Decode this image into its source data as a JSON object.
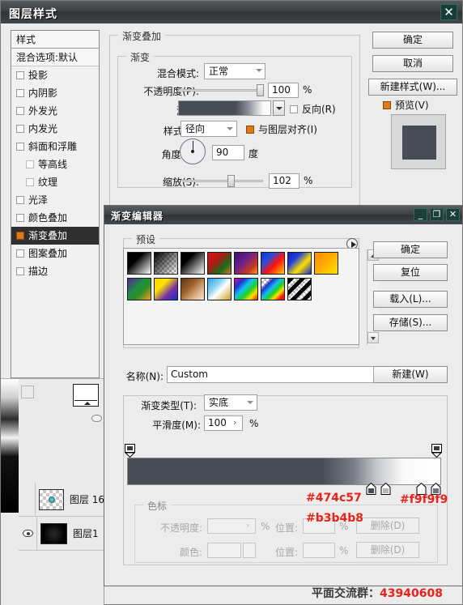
{
  "window": {
    "title": "图层样式",
    "close_label": "✕"
  },
  "sidebar": {
    "header": "样式",
    "blend_options": "混合选项:默认",
    "items": [
      {
        "label": "投影",
        "checked": false,
        "indent": false,
        "selected": false
      },
      {
        "label": "内阴影",
        "checked": false,
        "indent": false,
        "selected": false
      },
      {
        "label": "外发光",
        "checked": false,
        "indent": false,
        "selected": false
      },
      {
        "label": "内发光",
        "checked": false,
        "indent": false,
        "selected": false
      },
      {
        "label": "斜面和浮雕",
        "checked": false,
        "indent": false,
        "selected": false
      },
      {
        "label": "等高线",
        "checked": false,
        "indent": true,
        "selected": false
      },
      {
        "label": "纹理",
        "checked": false,
        "indent": true,
        "selected": false
      },
      {
        "label": "光泽",
        "checked": false,
        "indent": false,
        "selected": false
      },
      {
        "label": "颜色叠加",
        "checked": false,
        "indent": false,
        "selected": false
      },
      {
        "label": "渐变叠加",
        "checked": true,
        "indent": false,
        "selected": true
      },
      {
        "label": "图案叠加",
        "checked": false,
        "indent": false,
        "selected": false
      },
      {
        "label": "描边",
        "checked": false,
        "indent": false,
        "selected": false
      }
    ]
  },
  "commands": {
    "ok": "确定",
    "cancel": "取消",
    "new_style": "新建样式(W)...",
    "preview": "预览(V)"
  },
  "gradient_overlay": {
    "group_title": "渐变叠加",
    "sub_group_title": "渐变",
    "blend_mode_label": "混合模式:",
    "blend_mode_value": "正常",
    "opacity_label": "不透明度(P):",
    "opacity_value": "100",
    "opacity_unit": "%",
    "gradient_label": "渐变:",
    "reverse_label": "反向(R)",
    "style_label": "样式(L):",
    "style_value": "径向",
    "align_label": "与图层对齐(I)",
    "angle_label": "角度(N):",
    "angle_value": "90",
    "angle_unit": "度",
    "scale_label": "缩放(S):",
    "scale_value": "102",
    "scale_unit": "%"
  },
  "gradient_editor": {
    "title": "渐变编辑器",
    "minimize": "_",
    "maximize": "❐",
    "close": "✕",
    "presets_label": "预设",
    "buttons": {
      "ok": "确定",
      "reset": "复位",
      "load": "载入(L)...",
      "save": "存储(S)...",
      "new": "新建(W)"
    },
    "name_label": "名称(N):",
    "name_value": "Custom",
    "type_label": "渐变类型(T):",
    "type_value": "实底",
    "smooth_label": "平滑度(M):",
    "smooth_value": "100",
    "smooth_unit": "%",
    "stops_group": "色标",
    "opacity_label": "不透明度:",
    "opacity_value": "",
    "opacity_unit": "%",
    "color_label": "颜色:",
    "position_label": "位置:",
    "position_value": "",
    "position_unit": "%",
    "delete_label": "删除(D)",
    "presets": [
      "#ffffff",
      "#transparent",
      "#ffffff",
      "#cf1b1b",
      "#5a2a8f",
      "#1f3fd0",
      "#1a3fd6",
      "#ff8c00",
      "#6b2fa0",
      "#f2c200",
      "#a0522d",
      "#2aa3e8",
      "#ff0040",
      "#ffffff",
      "#000000"
    ]
  },
  "annotations": {
    "stop_left": "#474c57",
    "stop_right": "#f9f9f9",
    "stop_mid": "#b3b4b8"
  },
  "layers": [
    {
      "name": "图层 16",
      "visible": false
    },
    {
      "name": "图层1",
      "visible": true
    }
  ],
  "watermark": {
    "text": "平面交流群：",
    "number": "43940608"
  },
  "colors": {
    "accent": "#e07a18",
    "annotation_red": "#e8231a",
    "gradient_start": "#474c57",
    "gradient_end": "#f9f9f9",
    "titlebar": "#3d4043"
  }
}
